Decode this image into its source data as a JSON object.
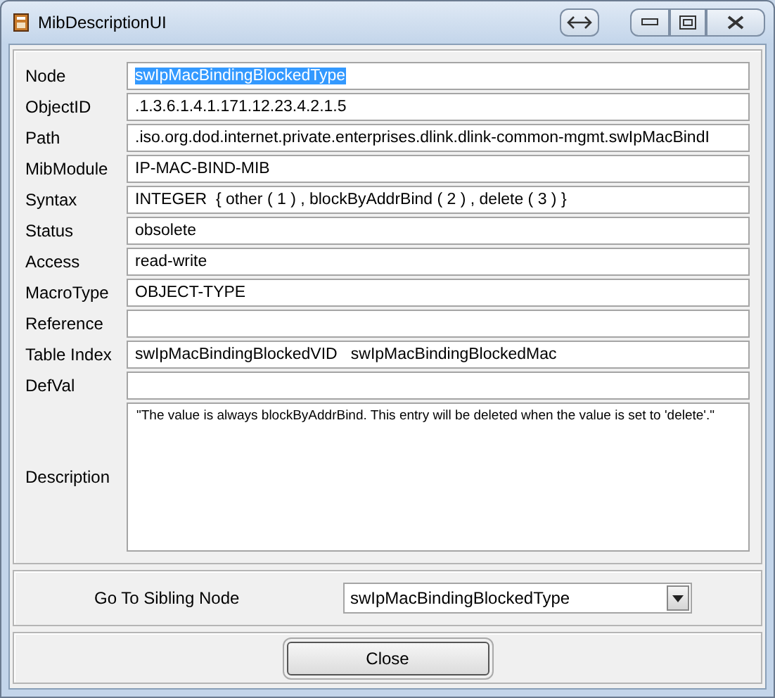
{
  "window": {
    "title": "MibDescriptionUI"
  },
  "fields": [
    {
      "kind": "line",
      "label": "Node",
      "value": "swIpMacBindingBlockedType",
      "text_selected": true
    },
    {
      "kind": "line",
      "label": "ObjectID",
      "value": ".1.3.6.1.4.1.171.12.23.4.2.1.5",
      "text_selected": false
    },
    {
      "kind": "line",
      "label": "Path",
      "value": ".iso.org.dod.internet.private.enterprises.dlink.dlink-common-mgmt.swIpMacBindI",
      "text_selected": false
    },
    {
      "kind": "line",
      "label": "MibModule",
      "value": "IP-MAC-BIND-MIB",
      "text_selected": false
    },
    {
      "kind": "line",
      "label": "Syntax",
      "value": "INTEGER  { other ( 1 ) , blockByAddrBind ( 2 ) , delete ( 3 ) }",
      "text_selected": false
    },
    {
      "kind": "line",
      "label": "Status",
      "value": "obsolete",
      "text_selected": false
    },
    {
      "kind": "line",
      "label": "Access",
      "value": "read-write",
      "text_selected": false
    },
    {
      "kind": "line",
      "label": "MacroType",
      "value": "OBJECT-TYPE",
      "text_selected": false
    },
    {
      "kind": "line",
      "label": "Reference"
    },
    {
      "kind": "line",
      "label": "Table Index",
      "value": "swIpMacBindingBlockedVID   swIpMacBindingBlockedMac",
      "text_selected": false
    },
    {
      "kind": "line",
      "label": "DefVal"
    },
    {
      "kind": "area",
      "label": "Description",
      "value": "\"The value is always blockByAddrBind. This entry will be deleted when the value is set to 'delete'.\"",
      "text_selected": false
    }
  ],
  "sibling": {
    "label": "Go To Sibling Node",
    "value": "swIpMacBindingBlockedType"
  },
  "buttons": [
    "Close"
  ]
}
